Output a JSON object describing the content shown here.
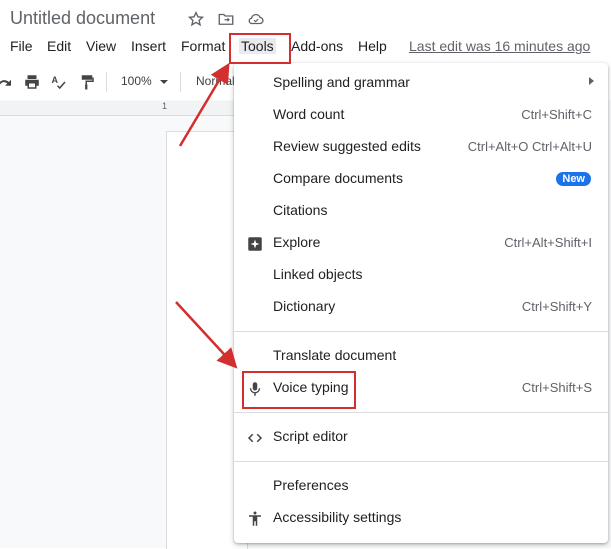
{
  "document": {
    "title": "Untitled document"
  },
  "title_icons": [
    "star-icon",
    "move-to-folder-icon",
    "cloud-status-icon"
  ],
  "menubar": {
    "items": [
      "File",
      "Edit",
      "View",
      "Insert",
      "Format",
      "Tools",
      "Add-ons",
      "Help"
    ],
    "active": "Tools",
    "last_edit": "Last edit was 16 minutes ago"
  },
  "toolbar": {
    "zoom": "100%",
    "style": "Normal",
    "icons": [
      "redo-icon",
      "print-icon",
      "spellcheck-icon",
      "paint-format-icon",
      "chevron-down-icon"
    ]
  },
  "ruler": {
    "label": "1"
  },
  "tools_menu": {
    "items": [
      {
        "label": "Spelling and grammar",
        "shortcut": "",
        "submenu": true
      },
      {
        "label": "Word count",
        "shortcut": "Ctrl+Shift+C"
      },
      {
        "label": "Review suggested edits",
        "shortcut": "Ctrl+Alt+O Ctrl+Alt+U"
      },
      {
        "label": "Compare documents",
        "badge": "New"
      },
      {
        "label": "Citations",
        "shortcut": ""
      },
      {
        "label": "Explore",
        "shortcut": "Ctrl+Alt+Shift+I",
        "icon": "explore-icon"
      },
      {
        "label": "Linked objects",
        "shortcut": ""
      },
      {
        "label": "Dictionary",
        "shortcut": "Ctrl+Shift+Y"
      },
      {
        "label": "Translate document",
        "shortcut": ""
      },
      {
        "label": "Voice typing",
        "shortcut": "Ctrl+Shift+S",
        "icon": "microphone-icon"
      },
      {
        "label": "Script editor",
        "shortcut": "",
        "icon": "code-icon"
      },
      {
        "label": "Preferences",
        "shortcut": ""
      },
      {
        "label": "Accessibility settings",
        "shortcut": "",
        "icon": "accessibility-icon"
      }
    ]
  },
  "annotation": {
    "color": "#d32f2f",
    "highlighted": [
      "Tools",
      "Voice typing"
    ]
  },
  "colors": {
    "accent": "#1a73e8",
    "menu_active_bg": "#e8eaed"
  }
}
